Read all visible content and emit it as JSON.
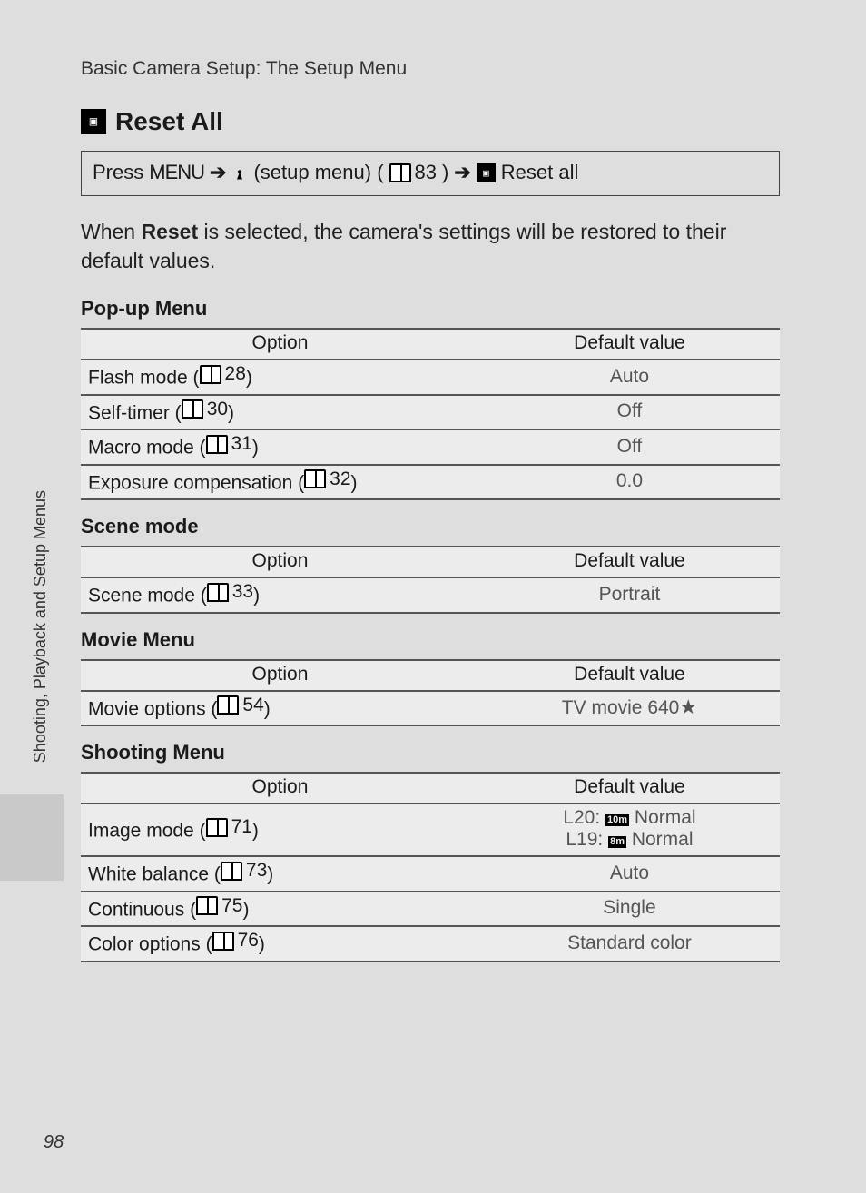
{
  "header": {
    "breadcrumb": "Basic Camera Setup: The Setup Menu"
  },
  "title": "Reset All",
  "nav": {
    "press": "Press",
    "menu": "MENU",
    "setup_menu": "(setup menu) (",
    "ref_setup": "83",
    "close": ")",
    "reset_all": "Reset all"
  },
  "description": {
    "pre": "When ",
    "bold": "Reset",
    "post": " is selected, the camera's settings will be restored to their default values."
  },
  "sections": [
    {
      "title": "Pop-up Menu",
      "head_opt": "Option",
      "head_val": "Default value",
      "rows": [
        {
          "opt_label": "Flash mode",
          "opt_ref": "28",
          "val": "Auto"
        },
        {
          "opt_label": "Self-timer",
          "opt_ref": "30",
          "val": "Off"
        },
        {
          "opt_label": "Macro mode",
          "opt_ref": "31",
          "val": "Off"
        },
        {
          "opt_label": "Exposure compensation",
          "opt_ref": "32",
          "val": "0.0"
        }
      ]
    },
    {
      "title": "Scene mode",
      "head_opt": "Option",
      "head_val": "Default value",
      "rows": [
        {
          "opt_label": "Scene mode",
          "opt_ref": "33",
          "val": "Portrait"
        }
      ]
    },
    {
      "title": "Movie Menu",
      "head_opt": "Option",
      "head_val": "Default value",
      "rows": [
        {
          "opt_label": "Movie options",
          "opt_ref": "54",
          "val": "TV movie 640",
          "val_extra": "star"
        }
      ]
    },
    {
      "title": "Shooting Menu",
      "head_opt": "Option",
      "head_val": "Default value",
      "rows": [
        {
          "opt_label": "Image mode",
          "opt_ref": "71",
          "val_lines": [
            {
              "prefix": "L20: ",
              "badge": "10m",
              "suffix": " Normal"
            },
            {
              "prefix": "L19: ",
              "badge": "8m",
              "suffix": " Normal"
            }
          ]
        },
        {
          "opt_label": "White balance",
          "opt_ref": "73",
          "val": "Auto"
        },
        {
          "opt_label": "Continuous",
          "opt_ref": "75",
          "val": "Single"
        },
        {
          "opt_label": "Color options",
          "opt_ref": "76",
          "val": "Standard color"
        }
      ]
    }
  ],
  "sidebar": "Shooting, Playback and Setup Menus",
  "page": "98"
}
